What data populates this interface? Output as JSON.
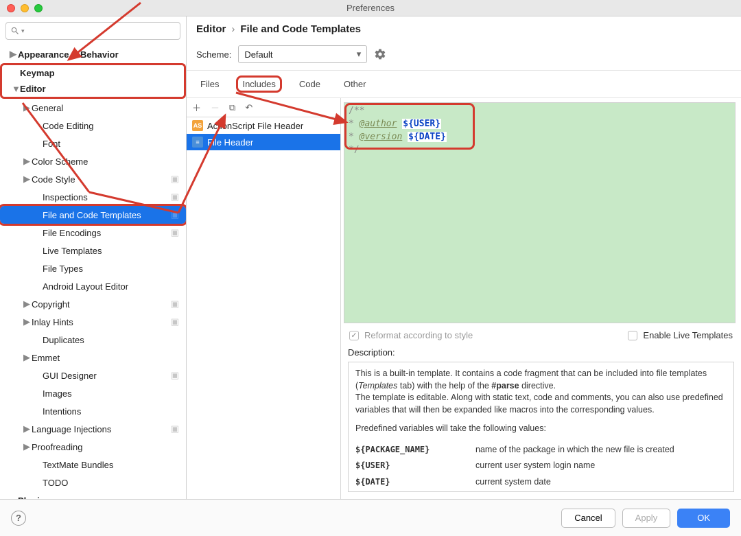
{
  "window": {
    "title": "Preferences"
  },
  "sidebar": {
    "search_placeholder": "",
    "items": [
      {
        "label": "Appearance & Behavior",
        "caret": "▶",
        "bold": true
      },
      {
        "label": "Keymap",
        "bold": true
      },
      {
        "label": "Editor",
        "caret": "▼",
        "bold": true
      },
      {
        "label": "General",
        "caret": "▶",
        "lvl": 2
      },
      {
        "label": "Code Editing",
        "lvl": 3
      },
      {
        "label": "Font",
        "lvl": 3
      },
      {
        "label": "Color Scheme",
        "caret": "▶",
        "lvl": 2
      },
      {
        "label": "Code Style",
        "caret": "▶",
        "lvl": 2,
        "ind": true
      },
      {
        "label": "Inspections",
        "lvl": 3,
        "ind": true
      },
      {
        "label": "File and Code Templates",
        "lvl": 3,
        "sel": true,
        "ind": true
      },
      {
        "label": "File Encodings",
        "lvl": 3,
        "ind": true
      },
      {
        "label": "Live Templates",
        "lvl": 3
      },
      {
        "label": "File Types",
        "lvl": 3
      },
      {
        "label": "Android Layout Editor",
        "lvl": 3
      },
      {
        "label": "Copyright",
        "caret": "▶",
        "lvl": 2,
        "ind": true
      },
      {
        "label": "Inlay Hints",
        "caret": "▶",
        "lvl": 2,
        "ind": true
      },
      {
        "label": "Duplicates",
        "lvl": 3
      },
      {
        "label": "Emmet",
        "caret": "▶",
        "lvl": 2
      },
      {
        "label": "GUI Designer",
        "lvl": 3,
        "ind": true
      },
      {
        "label": "Images",
        "lvl": 3
      },
      {
        "label": "Intentions",
        "lvl": 3
      },
      {
        "label": "Language Injections",
        "caret": "▶",
        "lvl": 2,
        "ind": true
      },
      {
        "label": "Proofreading",
        "caret": "▶",
        "lvl": 2
      },
      {
        "label": "TextMate Bundles",
        "lvl": 3
      },
      {
        "label": "TODO",
        "lvl": 3
      },
      {
        "label": "Plugins",
        "bold": true
      }
    ]
  },
  "crumbs": {
    "root": "Editor",
    "leaf": "File and Code Templates"
  },
  "scheme": {
    "label": "Scheme:",
    "value": "Default"
  },
  "tabs": {
    "files": "Files",
    "includes": "Includes",
    "code": "Code",
    "other": "Other"
  },
  "templates": {
    "items": [
      {
        "label": "ActionScript File Header",
        "icon": "orange",
        "abbr": "AS"
      },
      {
        "label": "File Header",
        "icon": "blue",
        "abbr": "≡",
        "sel": true
      }
    ]
  },
  "editor": {
    "line1_prefix": "/**",
    "line2_star": " * ",
    "line2_tag": "@author",
    "line2_var": "${USER}",
    "line3_star": " * ",
    "line3_tag": "@version",
    "line3_var": "${DATE}",
    "line4": "*/"
  },
  "reformat": {
    "label_reformat": "Reformat according to style",
    "label_live": "Enable Live Templates"
  },
  "desc": {
    "heading": "Description:",
    "p1a": "This is a built-in template. It contains a code fragment that can be included into file templates (",
    "p1i": "Templates",
    "p1b": " tab) with the help of the ",
    "p1bold": "#parse",
    "p1c": " directive.",
    "p2": "The template is editable. Along with static text, code and comments, you can also use predefined variables that will then be expanded like macros into the corresponding values.",
    "p3": "Predefined variables will take the following values:",
    "vars": [
      {
        "k": "${PACKAGE_NAME}",
        "d": "name of the package in which the new file is created"
      },
      {
        "k": "${USER}",
        "d": "current user system login name"
      },
      {
        "k": "${DATE}",
        "d": "current system date"
      }
    ]
  },
  "footer": {
    "cancel": "Cancel",
    "apply": "Apply",
    "ok": "OK"
  }
}
